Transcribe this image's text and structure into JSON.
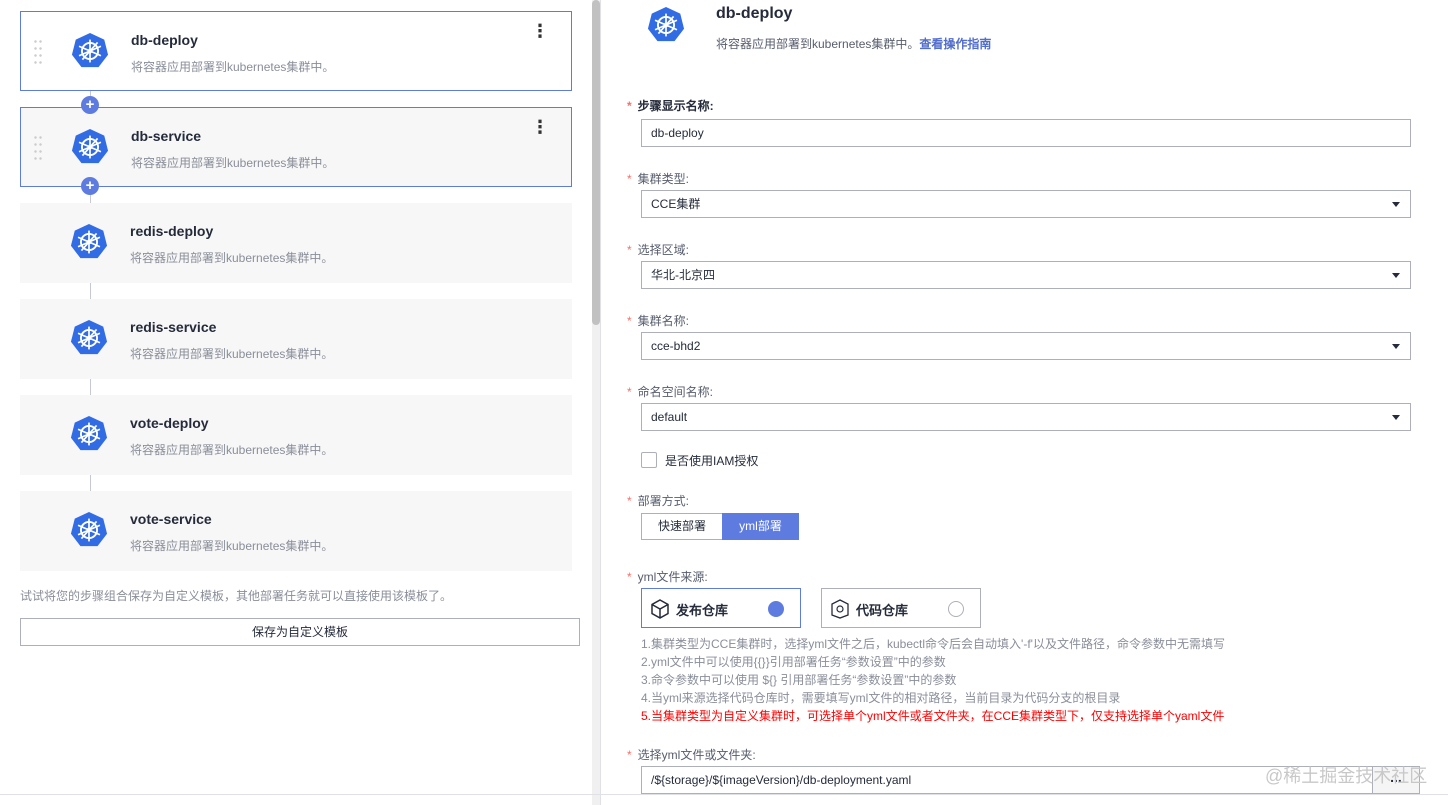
{
  "steps": [
    {
      "title": "db-deploy",
      "desc": "将容器应用部署到kubernetes集群中。"
    },
    {
      "title": "db-service",
      "desc": "将容器应用部署到kubernetes集群中。"
    },
    {
      "title": "redis-deploy",
      "desc": "将容器应用部署到kubernetes集群中。"
    },
    {
      "title": "redis-service",
      "desc": "将容器应用部署到kubernetes集群中。"
    },
    {
      "title": "vote-deploy",
      "desc": "将容器应用部署到kubernetes集群中。"
    },
    {
      "title": "vote-service",
      "desc": "将容器应用部署到kubernetes集群中。"
    }
  ],
  "left": {
    "tip": "试试将您的步骤组合保存为自定义模板，其他部署任务就可以直接使用该模板了。",
    "save_template": "保存为自定义模板",
    "more": "⋮",
    "plus": "+"
  },
  "header": {
    "title": "db-deploy",
    "subtitle": "将容器应用部署到kubernetes集群中。",
    "guide_link": "查看操作指南"
  },
  "form": {
    "required": "*",
    "step_name_label": "步骤显示名称:",
    "step_name": "db-deploy",
    "cluster_type_label": "集群类型:",
    "cluster_type": "CCE集群",
    "region_label": "选择区域:",
    "region": "华北-北京四",
    "cluster_name_label": "集群名称:",
    "cluster_name": "cce-bhd2",
    "namespace_label": "命名空间名称:",
    "namespace": "default",
    "iam_label": "是否使用IAM授权",
    "iam_checked": false,
    "deploy_mode_label": "部署方式:",
    "deploy_modes": [
      "快速部署",
      "yml部署"
    ],
    "deploy_mode_selected": "yml部署",
    "yml_source_label": "yml文件来源:",
    "yml_sources": [
      "发布仓库",
      "代码仓库"
    ],
    "yml_source_selected": "发布仓库",
    "notes": [
      "1.集群类型为CCE集群时，选择yml文件之后，kubectl命令后会自动填入'-f'以及文件路径，命令参数中无需填写",
      "2.yml文件中可以使用{{}}引用部署任务“参数设置”中的参数",
      "3.命令参数中可以使用 ${} 引用部署任务“参数设置”中的参数",
      "4.当yml来源选择代码仓库时，需要填写yml文件的相对路径，当前目录为代码分支的根目录",
      "5.当集群类型为自定义集群时，可选择单个yml文件或者文件夹，在CCE集群类型下，仅支持选择单个yaml文件"
    ],
    "yml_path_label": "选择yml文件或文件夹:",
    "yml_path": "/${storage}/${imageVersion}/db-deployment.yaml",
    "browse": "..."
  },
  "watermark": "@稀土掘金技术社区",
  "colors": {
    "accent": "#5e7ce0",
    "kubernetes": "#326ce5",
    "warning": "#ff0000"
  }
}
